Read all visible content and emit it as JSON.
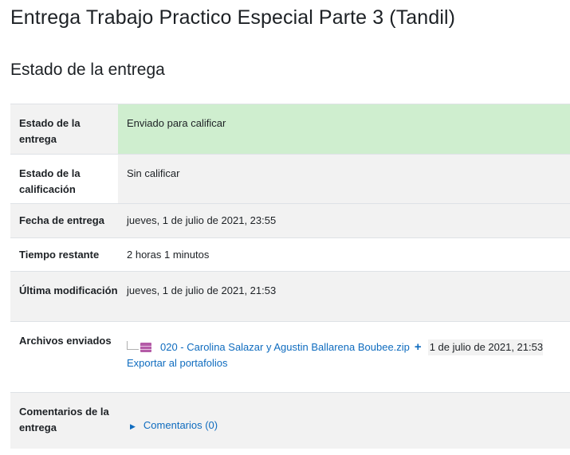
{
  "page": {
    "title": "Entrega Trabajo Practico Especial Parte 3 (Tandil)"
  },
  "section": {
    "title": "Estado de la entrega"
  },
  "rows": {
    "estado_entrega": {
      "label": "Estado de la entrega",
      "value": "Enviado para calificar"
    },
    "estado_calificacion": {
      "label": "Estado de la calificación",
      "value": "Sin calificar"
    },
    "fecha_entrega": {
      "label": "Fecha de entrega",
      "value": "jueves, 1 de julio de 2021, 23:55"
    },
    "tiempo_restante": {
      "label": "Tiempo restante",
      "value": "2 horas 1 minutos"
    },
    "ultima_modificacion": {
      "label": "Última modificación",
      "value": "jueves, 1 de julio de 2021, 21:53"
    },
    "archivos_enviados": {
      "label": "Archivos enviados",
      "file_name": "020 - Carolina Salazar y Agustin Ballarena Boubee.zip",
      "plus": "+",
      "file_date": "1 de julio de 2021, 21:53",
      "export_link": "Exportar al portafolios"
    },
    "comentarios": {
      "label": "Comentarios de la entrega",
      "link": "Comentarios (0)",
      "caret": "▶"
    }
  },
  "colors": {
    "submitted_bg": "#cfeecf",
    "link": "#0f6cbf",
    "zip_icon": "#b45ba7"
  }
}
